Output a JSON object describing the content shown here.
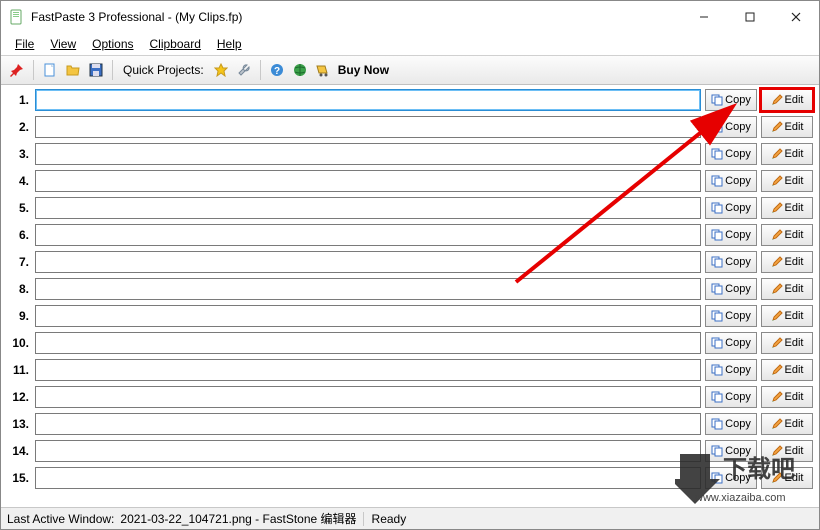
{
  "window": {
    "title": "FastPaste 3 Professional -  (My Clips.fp)"
  },
  "menu": {
    "file": "File",
    "view": "View",
    "options": "Options",
    "clipboard": "Clipboard",
    "help": "Help"
  },
  "toolbar": {
    "quick_projects": "Quick Projects:",
    "buy_now": "Buy Now"
  },
  "clips": {
    "empty_text": "<empty>",
    "copy_label": "Copy",
    "edit_label": "Edit",
    "rows": [
      {
        "n": "1.",
        "value": "",
        "active": true
      },
      {
        "n": "2.",
        "value": "<empty>"
      },
      {
        "n": "3.",
        "value": "<empty>"
      },
      {
        "n": "4.",
        "value": "<empty>"
      },
      {
        "n": "5.",
        "value": "<empty>"
      },
      {
        "n": "6.",
        "value": "<empty>"
      },
      {
        "n": "7.",
        "value": "<empty>"
      },
      {
        "n": "8.",
        "value": "<empty>"
      },
      {
        "n": "9.",
        "value": "<empty>"
      },
      {
        "n": "10.",
        "value": "<empty>"
      },
      {
        "n": "11.",
        "value": "<empty>"
      },
      {
        "n": "12.",
        "value": "<empty>"
      },
      {
        "n": "13.",
        "value": "<empty>"
      },
      {
        "n": "14.",
        "value": "<empty>"
      },
      {
        "n": "15.",
        "value": "<empty>"
      }
    ]
  },
  "status": {
    "last_active_label": "Last Active Window:",
    "last_active_value": "2021-03-22_104721.png - FastStone 编辑器",
    "ready": "Ready"
  },
  "watermark": {
    "text_cn": "下载吧",
    "text_url": "www.xiazaiba.com"
  }
}
